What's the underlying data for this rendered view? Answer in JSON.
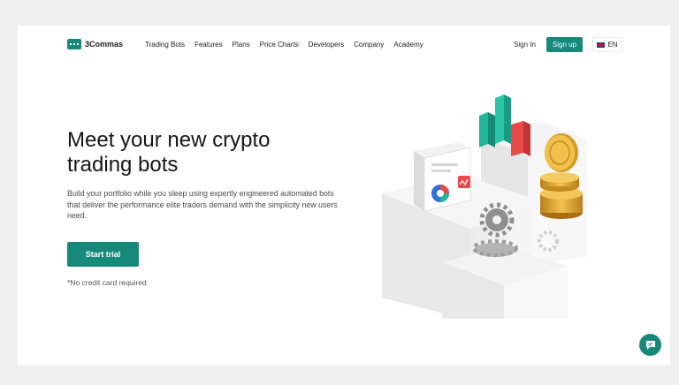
{
  "header": {
    "brand": "3Commas",
    "nav": [
      "Trading Bots",
      "Features",
      "Plans",
      "Price Charts",
      "Developers",
      "Company",
      "Academy"
    ],
    "sign_in": "Sign In",
    "sign_up": "Sign up",
    "language": "EN"
  },
  "hero": {
    "headline_line1": "Meet your new crypto",
    "headline_line2": "trading bots",
    "subtitle": "Build your portfolio while you sleep using expertly engineered automated bots that deliver the performance elite traders demand with the simplicity new users need.",
    "cta": "Start trial",
    "note": "*No credit card required"
  },
  "colors": {
    "accent": "#16897a",
    "background": "#efefef",
    "surface": "#ffffff"
  },
  "icons": [
    "logo-icon",
    "uk-flag-icon",
    "chat-icon"
  ]
}
